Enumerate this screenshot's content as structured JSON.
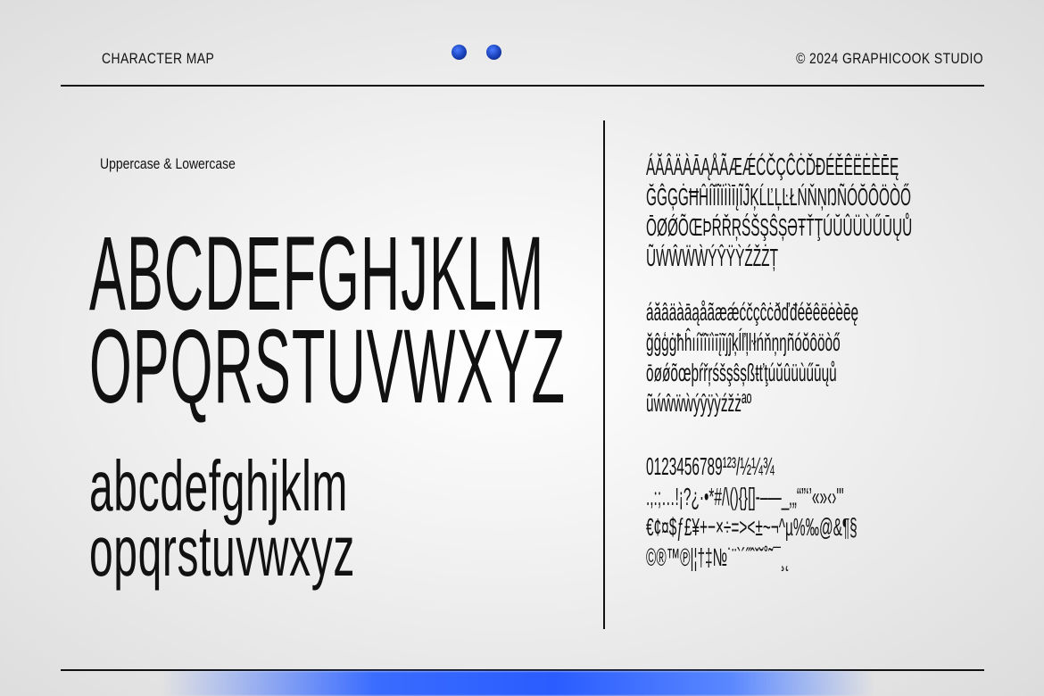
{
  "header": {
    "left_title": "CHARACTER MAP",
    "right_title": "© 2024 GRAPHICOOK STUDIO",
    "dot_color": "#1a44c8"
  },
  "left": {
    "subheading": "Uppercase & Lowercase",
    "uppercase_line1": "ABCDEFGHJKLM",
    "uppercase_line2": "OPQRSTUVWXYZ",
    "lowercase_line1": "abcdefghjklm",
    "lowercase_line2": "opqrstuvwxyz"
  },
  "right": {
    "uppercase_accents": [
      "ÁĂÂÄÀĀĄÅÃÆǼĆČÇĈĊĎĐÉĚÊËĖÈĒĘ",
      "ĞĜĢĠĦĤÍĬÎÏİÌĪĮĨĴĶĹĽĻĿŁŃŇŅŊÑÓŎÔÖÒŐ",
      "ŌØǾÕŒÞŔŘŖŚŠŞŜȘƏŦŤŢÚŬÛÜÙŰŪŲŮ",
      "ŨẂŴẄẀÝŶŸỲŹŽŻȚ"
    ],
    "lowercase_accents": [
      "áăâäàāąåãæǽćčçĉċðďđéěêëėèēę",
      "ğĝģġħĥıíĭîïìīįĩȷĵķĺľļŀłńňņŋñóŏôöòő",
      "ōøǿõœþŕřŗśšşŝșßŧťţúŭûüùűūųů",
      "ũẃŵẅẁýŷÿỳźžżªº"
    ],
    "figures_symbols": [
      "0123456789¹²³/½¼¾",
      ".,:;…!¡?¿·•*#/\\(){}[]-–—_‚„“”‘’«»‹›\"'",
      "€¢¤$ƒ£¥+−×÷=><±~¬^µ%‰@&¶§",
      "©®™℗|¦†‡№˙¨`´˝ˆˇ˘˚˜¯¸˛"
    ]
  }
}
